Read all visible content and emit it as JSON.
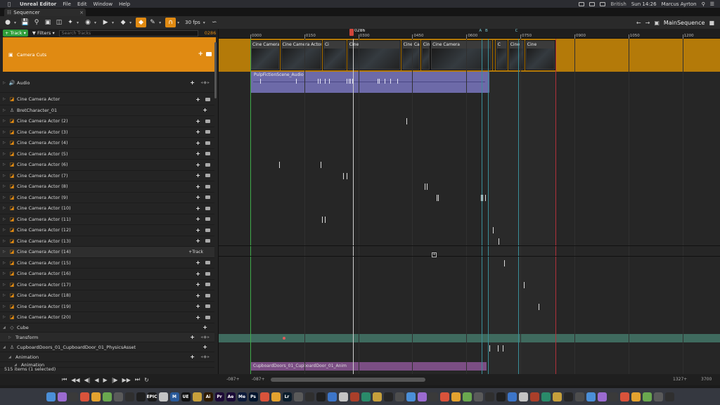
{
  "menubar": {
    "app_name": "Unreal Editor",
    "items": [
      "File",
      "Edit",
      "Window",
      "Help"
    ],
    "language": "British",
    "clock": "Sun 14:26",
    "user": "Marcus Ayrton"
  },
  "tab": {
    "label": "Sequencer"
  },
  "toolbar": {
    "fps": "30 fps",
    "sequence_name": "MainSequence"
  },
  "filterbar": {
    "track_label": "Track",
    "filters_label": "Filters",
    "search_placeholder": "Search Tracks",
    "current_time": "0286"
  },
  "tracks": {
    "camera_cuts": "Camera Cuts",
    "audio": "Audio",
    "rows": [
      "Cine Camera Actor",
      "BretCharacter_01",
      "Cine Camera Actor (2)",
      "Cine Camera Actor (3)",
      "Cine Camera Actor (4)",
      "Cine Camera Actor (5)",
      "Cine Camera Actor (6)",
      "Cine Camera Actor (7)",
      "Cine Camera Actor (8)",
      "Cine Camera Actor (9)",
      "Cine Camera Actor (10)",
      "Cine Camera Actor (11)",
      "Cine Camera Actor (12)",
      "Cine Camera Actor (13)",
      "Cine Camera Actor (14)",
      "Cine Camera Actor (15)",
      "Cine Camera Actor (16)",
      "Cine Camera Actor (17)",
      "Cine Camera Actor (18)",
      "Cine Camera Actor (19)",
      "Cine Camera Actor (20)"
    ],
    "track_button_label": "Track",
    "cube": "Cube",
    "transform": "Transform",
    "cupboard": "CupboardDoors_01_CupboardDoor_01_PhysicsAsset",
    "animation": "Animation",
    "animation_sub": "Animation"
  },
  "status": {
    "items_text": "515 items (1 selected)"
  },
  "timeline": {
    "ruler": [
      "0000",
      "0150",
      "0300",
      "0450",
      "0600",
      "0750",
      "0900",
      "1050",
      "1200"
    ],
    "playhead": "0286",
    "markers": [
      "A",
      "B",
      "C"
    ],
    "camera_sections": [
      "Cine Camera",
      "Cine Camera Actor",
      "Ci",
      "Cine",
      "Cine Camera Actor (5)",
      "Cine",
      "Cine Camera",
      "Cine Camera",
      "C",
      "Cine",
      "Cine"
    ],
    "audio_clip": "PulpFictionScene_Audio",
    "anim_clip": "CupboardDoors_01_CupboardDoor_01_Anim"
  },
  "bottombar": {
    "range_start_a": "-087+",
    "range_start_b": "-087+",
    "range_end_a": "1327+",
    "range_end_b": "3700"
  },
  "dock": {
    "apps": [
      "Ai",
      "Pr",
      "Ae",
      "Me",
      "Ps",
      "Lr",
      "EPIC",
      "M",
      "UE"
    ]
  }
}
